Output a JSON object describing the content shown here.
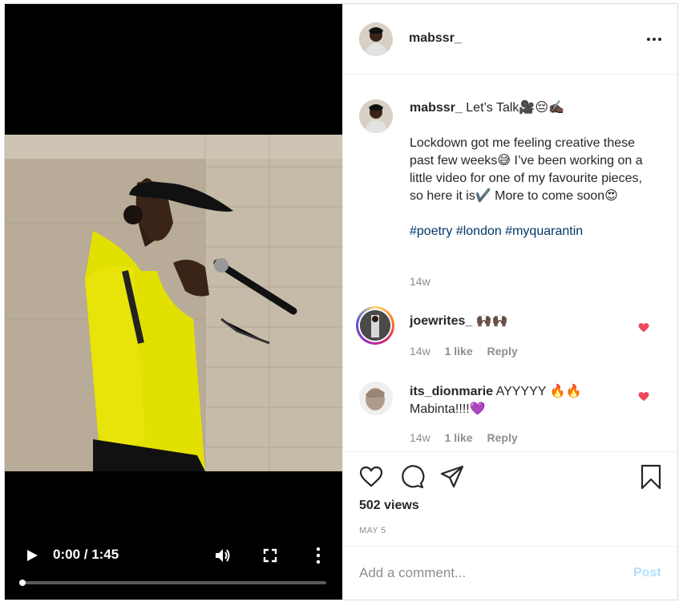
{
  "video": {
    "time": "0:00 / 1:45",
    "progress": 0,
    "icons": [
      "play-icon",
      "volume-icon",
      "fullscreen-icon",
      "more-vert-icon"
    ]
  },
  "header": {
    "username": "mabssr_"
  },
  "caption": {
    "username": "mabssr_",
    "title": "Let’s Talk🎥😔✍🏿",
    "body": "Lockdown got me feeling creative these past few weeks😅 I’ve been working on a little video for one of my favourite pieces, so here it is✔️ More to come soon😍",
    "hashtags": "#poetry #london #myquarantin",
    "time": "14w"
  },
  "comments": [
    {
      "username": "joewrites_",
      "text": "🙌🏿🙌🏿",
      "time": "14w",
      "likes": "1 like",
      "reply": "Reply"
    },
    {
      "username": "its_dionmarie",
      "text": "AYYYYY 🔥🔥 Mabinta!!!!💜",
      "time": "14w",
      "likes": "1 like",
      "reply": "Reply"
    }
  ],
  "stats": {
    "views": "502 views",
    "date": "MAY 5"
  },
  "add_comment": {
    "placeholder": "Add a comment...",
    "post_label": "Post"
  },
  "colors": {
    "heart": "#ed4956",
    "link": "#00376b",
    "muted": "#8e8e8e",
    "post_disabled": "#b2dffc"
  }
}
